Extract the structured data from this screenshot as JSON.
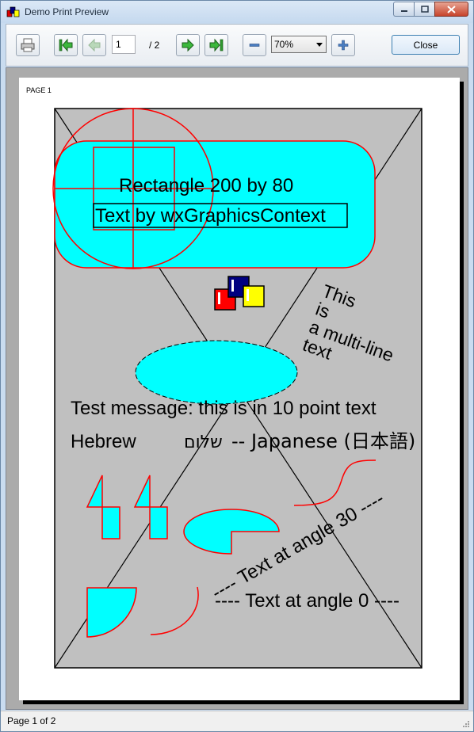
{
  "window": {
    "title": "Demo Print Preview"
  },
  "toolbar": {
    "print_icon": "printer-icon",
    "first_icon": "first-page-icon",
    "prev_icon": "previous-page-icon",
    "page_value": "1",
    "page_total": "/ 2",
    "next_icon": "next-page-icon",
    "last_icon": "last-page-icon",
    "zoom_out_icon": "zoom-out-icon",
    "zoom_value": "70%",
    "zoom_in_icon": "zoom-in-icon",
    "close_label": "Close"
  },
  "page": {
    "label": "PAGE 1",
    "rect_text": "Rectangle 200 by  80",
    "gc_text": "Text by wxGraphicsContext",
    "multiline": [
      "This",
      "is",
      "a multi-line",
      "text"
    ],
    "test_message": "Test message: this is in 10 point text",
    "hebrew_label": "Hebrew",
    "hebrew_text": "שלום",
    "japanese_text": "-- Japanese (日本語)",
    "angle30": "---- Text at angle 30 ----",
    "angle0": "---- Text at angle 0 ----"
  },
  "colors": {
    "cyan": "#00ffff",
    "red": "#ff0000",
    "grey": "#c0c0c0",
    "navy": "#000080",
    "yellow": "#ffff00"
  },
  "status": {
    "text": "Page 1 of 2"
  }
}
